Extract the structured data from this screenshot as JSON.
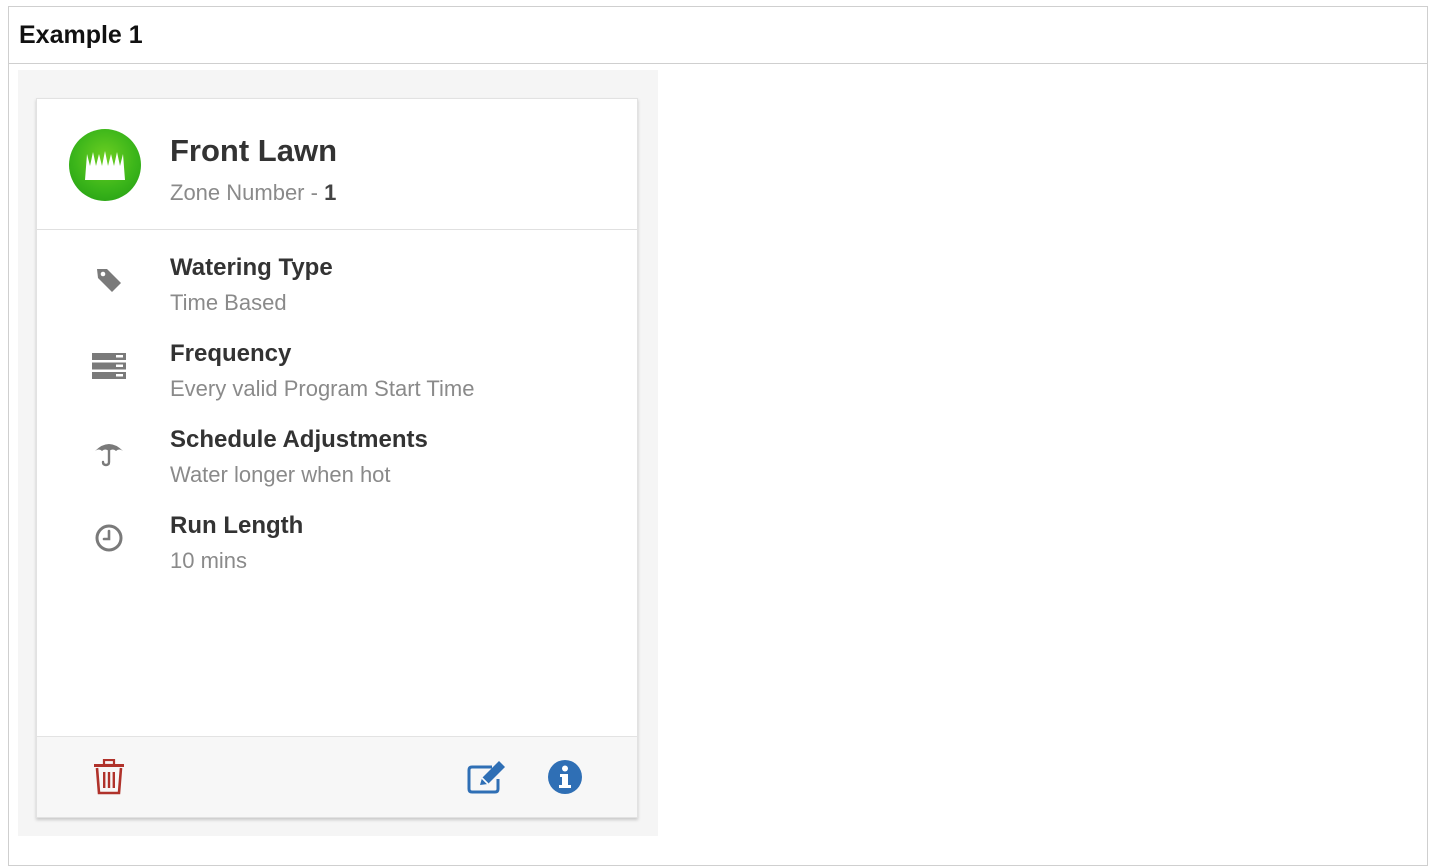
{
  "example": {
    "title": "Example 1"
  },
  "zone": {
    "name": "Front Lawn",
    "number_label": "Zone Number - ",
    "number": "1",
    "avatar_icon": "grass-icon"
  },
  "details": [
    {
      "icon": "tag-icon",
      "label": "Watering Type",
      "value": "Time Based"
    },
    {
      "icon": "server-stack-icon",
      "label": "Frequency",
      "value": "Every valid Program Start Time"
    },
    {
      "icon": "umbrella-icon",
      "label": "Schedule Adjustments",
      "value": "Water longer when hot"
    },
    {
      "icon": "clock-icon",
      "label": "Run Length",
      "value": "10 mins"
    }
  ],
  "footer": {
    "delete_icon": "trash-icon",
    "edit_icon": "edit-icon",
    "info_icon": "info-icon"
  },
  "colors": {
    "avatar_green": "#3bb51a",
    "delete_red": "#b0322b",
    "action_blue": "#2f6fb5",
    "icon_gray": "#7a7a7a"
  }
}
